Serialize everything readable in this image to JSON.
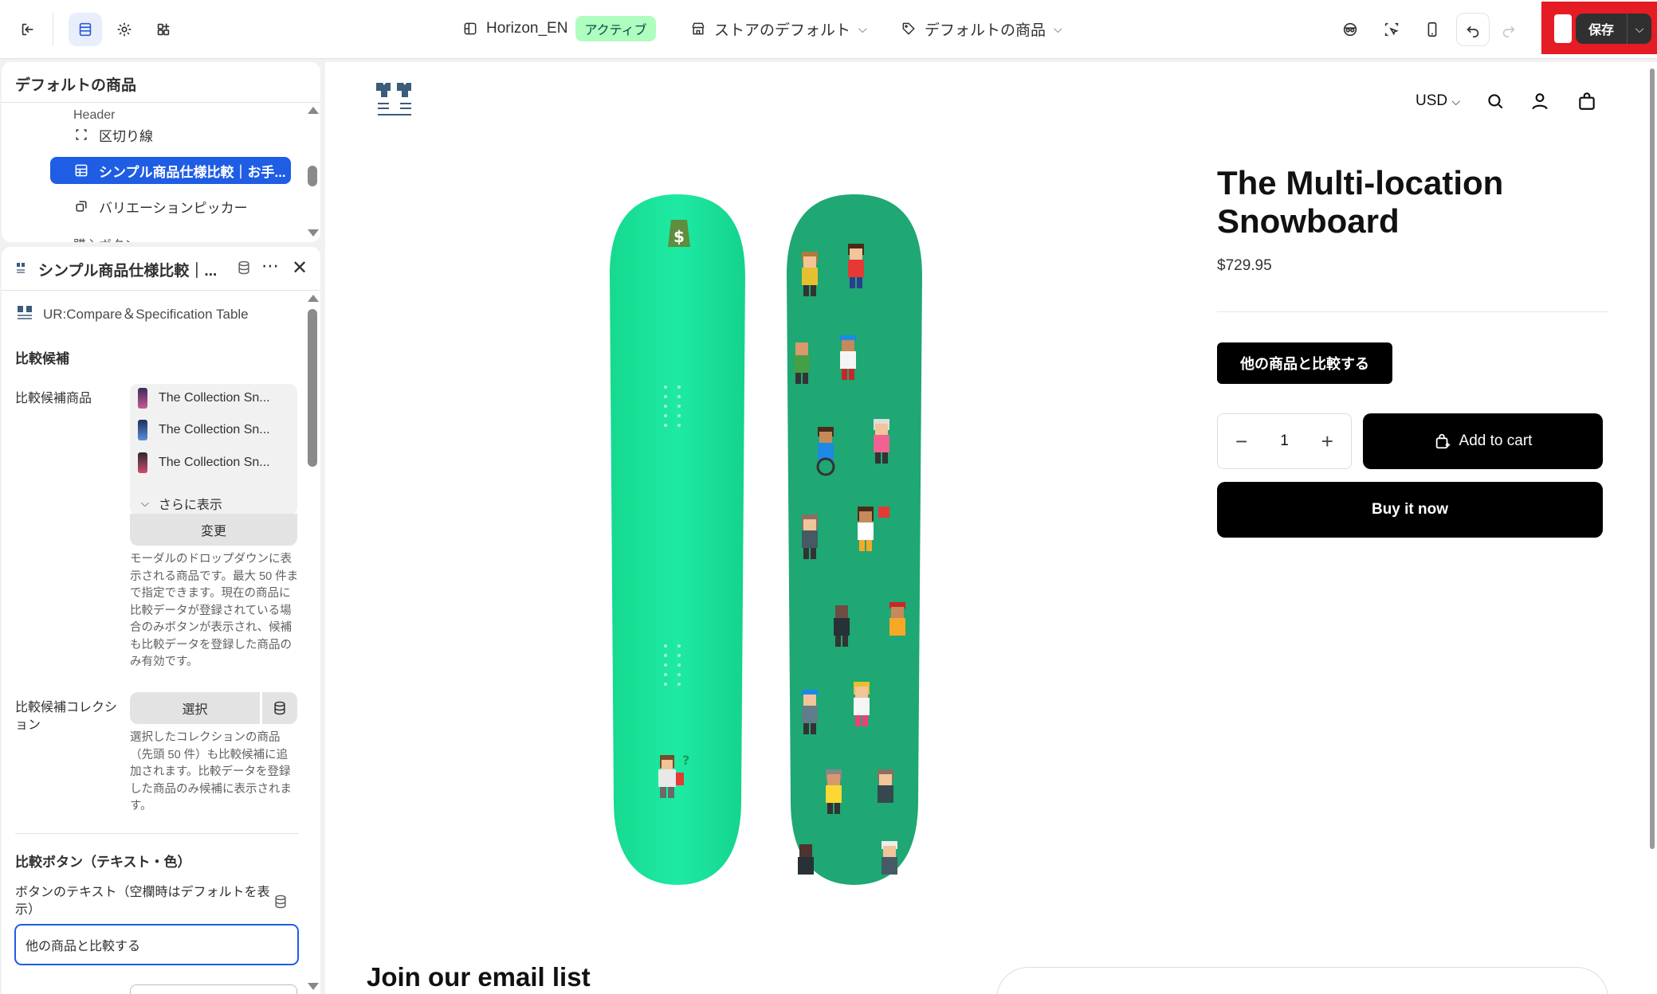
{
  "topbar": {
    "theme_name": "Horizon_EN",
    "theme_status": "アクティブ",
    "store_default": "ストアのデフォルト",
    "default_product": "デフォルトの商品",
    "save_label": "保存"
  },
  "tree": {
    "title": "デフォルトの商品",
    "cut_top": "Header",
    "items": [
      {
        "label": "区切り線",
        "icon": "divider-icon"
      },
      {
        "label": "シンプル商品仕様比較｜お手...",
        "icon": "table-icon",
        "selected": true
      },
      {
        "label": "バリエーションピッカー",
        "icon": "variant-icon"
      }
    ],
    "cut_bottom": "購入ボタン"
  },
  "settings": {
    "title": "シンプル商品仕様比較｜...",
    "app_name": "UR:Compare＆Specification Table",
    "section_candidates": "比較候補",
    "candidate_products_label": "比較候補商品",
    "products": [
      "The Collection Sn...",
      "The Collection Sn...",
      "The Collection Sn..."
    ],
    "show_more": "さらに表示",
    "change_button": "変更",
    "products_help": "モーダルのドロップダウンに表示される商品です。最大 50 件まで指定できます。現在の商品に比較データが登録されている場合のみボタンが表示され、候補も比較データを登録した商品のみ有効です。",
    "collection_label": "比較候補コレクション",
    "select_button": "選択",
    "collection_help": "選択したコレクションの商品（先頭 50 件）も比較候補に追加されます。比較データを登録した商品のみ候補に表示されます。",
    "section_button": "比較ボタン（テキスト・色）",
    "button_text_label": "ボタンのテキスト（空欄時はデフォルトを表示）",
    "button_text_value": "他の商品と比較する"
  },
  "preview": {
    "currency": "USD",
    "product_title": "The Multi-location Snowboard",
    "price": "$729.95",
    "compare_button": "他の商品と比較する",
    "quantity": "1",
    "add_to_cart": "Add to cart",
    "buy_now": "Buy it now",
    "email_heading": "Join our email list"
  },
  "colors": {
    "accent": "#1f5de4",
    "save_highlight": "#e51c23",
    "board_left": "#1ee9a3",
    "board_right": "#1fa774"
  }
}
